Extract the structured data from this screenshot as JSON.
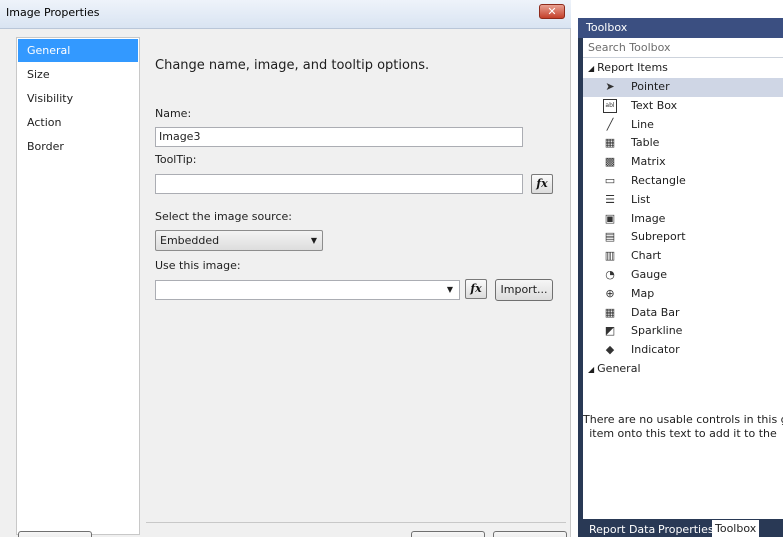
{
  "dialog": {
    "title": "Image Properties",
    "close_label": "✕",
    "nav": [
      "General",
      "Size",
      "Visibility",
      "Action",
      "Border"
    ],
    "selected_nav": "General",
    "heading": "Change name, image, and tooltip options.",
    "name_label": "Name:",
    "name_value": "Image3",
    "tooltip_label": "ToolTip:",
    "tooltip_value": "",
    "fx_label": "fx",
    "source_label": "Select the image source:",
    "source_value": "Embedded",
    "use_image_label": "Use this image:",
    "use_image_value": "",
    "import_label": "Import..."
  },
  "toolbox": {
    "title": "Toolbox",
    "search_placeholder": "Search Toolbox",
    "group_report_items": "Report Items",
    "items": [
      {
        "label": "Pointer",
        "icon": "pointer-icon"
      },
      {
        "label": "Text Box",
        "icon": "textbox-icon"
      },
      {
        "label": "Line",
        "icon": "line-icon"
      },
      {
        "label": "Table",
        "icon": "table-icon"
      },
      {
        "label": "Matrix",
        "icon": "matrix-icon"
      },
      {
        "label": "Rectangle",
        "icon": "rectangle-icon"
      },
      {
        "label": "List",
        "icon": "list-icon"
      },
      {
        "label": "Image",
        "icon": "image-icon"
      },
      {
        "label": "Subreport",
        "icon": "subreport-icon"
      },
      {
        "label": "Chart",
        "icon": "chart-icon"
      },
      {
        "label": "Gauge",
        "icon": "gauge-icon"
      },
      {
        "label": "Map",
        "icon": "map-icon"
      },
      {
        "label": "Data Bar",
        "icon": "databar-icon"
      },
      {
        "label": "Sparkline",
        "icon": "sparkline-icon"
      },
      {
        "label": "Indicator",
        "icon": "indicator-icon"
      }
    ],
    "group_general": "General",
    "empty_line1": "There are no usable controls in this gr",
    "empty_line2": "item onto this text to add it to the",
    "tabs": [
      "Report Data",
      "Properties",
      "Toolbox"
    ],
    "active_tab": "Toolbox"
  }
}
